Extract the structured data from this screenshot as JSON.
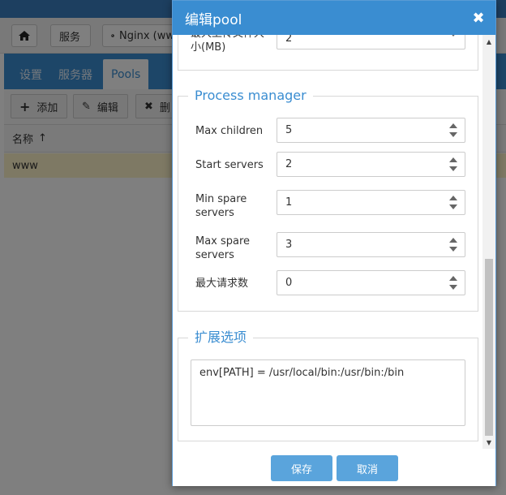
{
  "background": {
    "breadcrumb": {
      "home_icon": "home-icon",
      "items": [
        "服务",
        "Nginx (ww"
      ]
    },
    "tabs": [
      "设置",
      "服务器",
      "Pools"
    ],
    "active_tab": "Pools",
    "toolbar": {
      "add_label": "添加",
      "edit_label": "编辑",
      "delete_label": "删"
    },
    "table": {
      "column_name": "名称",
      "sort_indicator": "↑",
      "rows": [
        "www"
      ]
    }
  },
  "dialog": {
    "title": "编辑pool",
    "close_symbol": "✖",
    "partial_field": {
      "label": "最大上传文件大小(MB)",
      "value": "2"
    },
    "process_manager": {
      "legend": "Process manager",
      "fields": [
        {
          "label": "Max children",
          "value": "5"
        },
        {
          "label": "Start servers",
          "value": "2"
        },
        {
          "label": "Min spare servers",
          "value": "1"
        },
        {
          "label": "Max spare servers",
          "value": "3"
        },
        {
          "label": "最大请求数",
          "value": "0"
        }
      ]
    },
    "extended": {
      "legend": "扩展选项",
      "value": "env[PATH] = /usr/local/bin:/usr/bin:/bin"
    },
    "save_label": "保存",
    "cancel_label": "取消"
  },
  "colors": {
    "accent": "#3a8dd1",
    "button": "#5aa4dc",
    "selected_row": "#fdf3c9"
  }
}
